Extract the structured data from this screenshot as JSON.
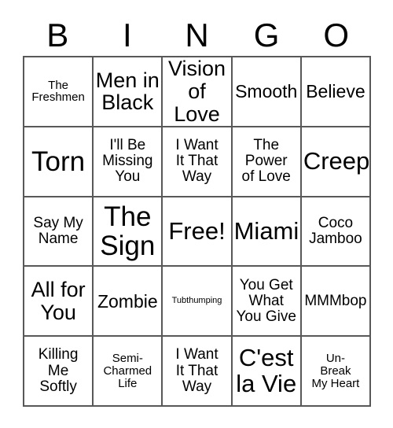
{
  "card": {
    "title": "BINGO",
    "header_letters": [
      "B",
      "I",
      "N",
      "G",
      "O"
    ],
    "free_space_label": "Free!",
    "rows": [
      [
        {
          "text": "The\nFreshmen",
          "size": "xs"
        },
        {
          "text": "Men in\nBlack",
          "size": "lg"
        },
        {
          "text": "Vision\nof Love",
          "size": "lg"
        },
        {
          "text": "Smooth",
          "size": "md"
        },
        {
          "text": "Believe",
          "size": "md"
        }
      ],
      [
        {
          "text": "Torn",
          "size": "xxl"
        },
        {
          "text": "I'll Be\nMissing\nYou",
          "size": "sm"
        },
        {
          "text": "I Want\nIt That\nWay",
          "size": "sm"
        },
        {
          "text": "The\nPower\nof Love",
          "size": "sm"
        },
        {
          "text": "Creep",
          "size": "xl"
        }
      ],
      [
        {
          "text": "Say My\nName",
          "size": "sm"
        },
        {
          "text": "The\nSign",
          "size": "xxl"
        },
        {
          "text": "Free!",
          "size": "xl"
        },
        {
          "text": "Miami",
          "size": "xl"
        },
        {
          "text": "Coco\nJamboo",
          "size": "sm"
        }
      ],
      [
        {
          "text": "All for\nYou",
          "size": "lg"
        },
        {
          "text": "Zombie",
          "size": "md"
        },
        {
          "text": "Tubthumping",
          "size": "xxs"
        },
        {
          "text": "You Get\nWhat\nYou Give",
          "size": "sm"
        },
        {
          "text": "MMMbop",
          "size": "sm"
        }
      ],
      [
        {
          "text": "Killing\nMe\nSoftly",
          "size": "sm"
        },
        {
          "text": "Semi-\nCharmed\nLife",
          "size": "xs"
        },
        {
          "text": "I Want\nIt That\nWay",
          "size": "sm"
        },
        {
          "text": "C'est\nla Vie",
          "size": "xl"
        },
        {
          "text": "Un-\nBreak\nMy Heart",
          "size": "xs"
        }
      ]
    ]
  },
  "colors": {
    "border": "#585858",
    "text": "#000000",
    "background": "#ffffff"
  }
}
